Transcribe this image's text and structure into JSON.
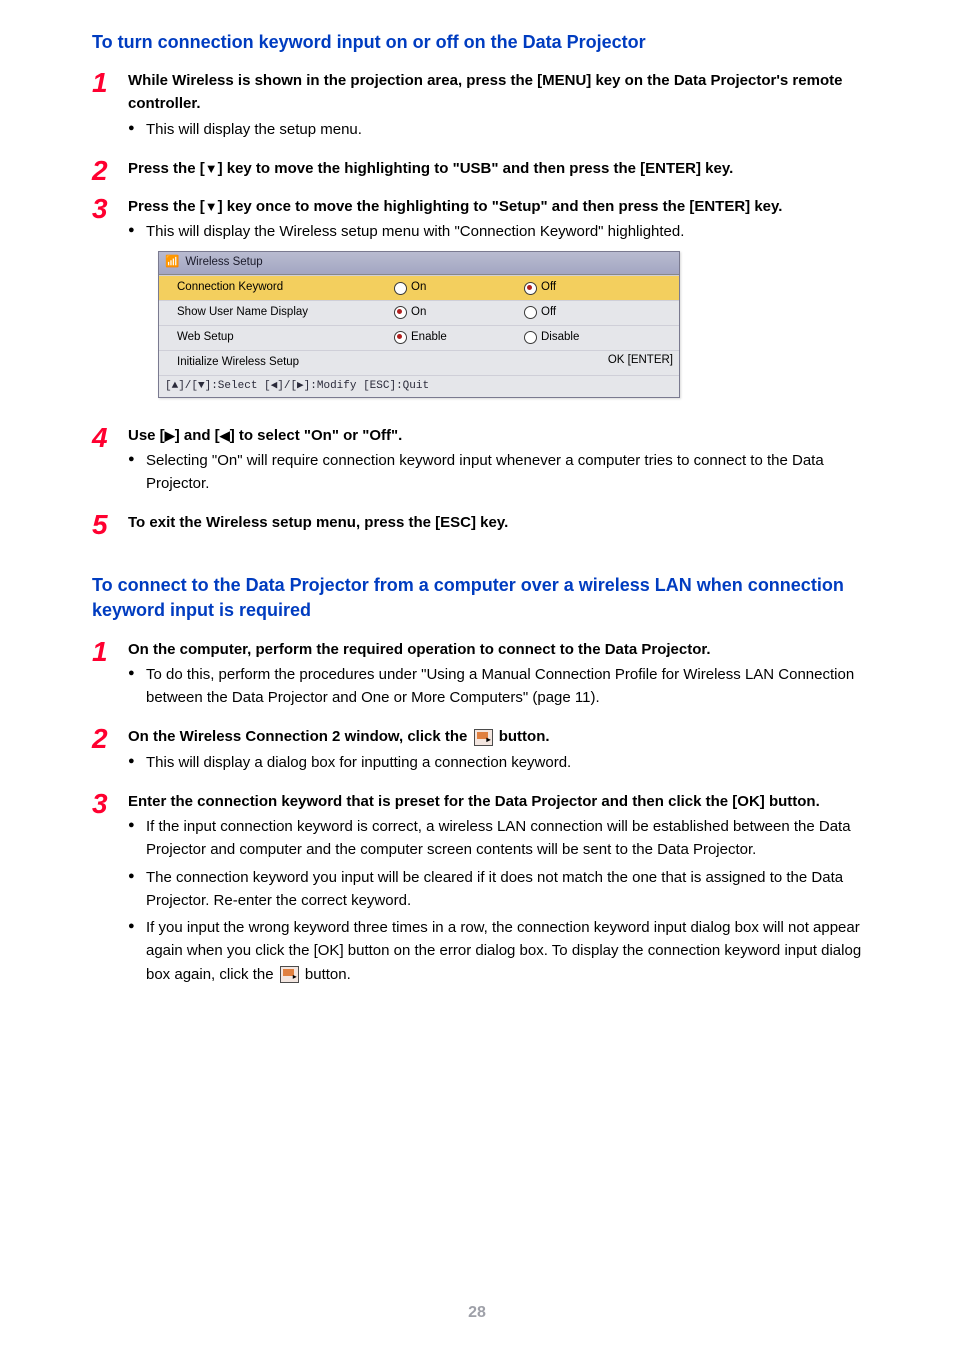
{
  "page_number": "28",
  "section1": {
    "heading": "To turn connection keyword input on or off on the Data Projector",
    "steps": [
      {
        "num": "1",
        "title": "While Wireless is shown in the projection area, press the [MENU] key on the Data Projector's remote controller.",
        "bullets": [
          "This will display the setup menu."
        ]
      },
      {
        "num": "2",
        "title_pre": "Press the [",
        "title_post": "] key to move the highlighting to \"USB\" and then press the [ENTER] key.",
        "bullets": []
      },
      {
        "num": "3",
        "title_pre": "Press the [",
        "title_post": "] key once to move the highlighting to \"Setup\" and then press the [ENTER] key.",
        "bullets": [
          "This will display the Wireless setup menu with \"Connection Keyword\" highlighted."
        ]
      },
      {
        "num": "4",
        "title_pre": "Use [",
        "title_mid": "] and [",
        "title_post": "] to select \"On\" or \"Off\".",
        "bullets": [
          "Selecting \"On\" will require connection keyword input whenever a computer tries to connect to the Data Projector."
        ]
      },
      {
        "num": "5",
        "title": "To exit the Wireless setup menu, press the [ESC] key.",
        "bullets": []
      }
    ]
  },
  "wireless_table": {
    "title": "Wireless Setup",
    "rows": [
      {
        "label": "Connection Keyword",
        "opt1": "On",
        "opt2": "Off",
        "selected": 2,
        "highlight": true
      },
      {
        "label": "Show User Name Display",
        "opt1": "On",
        "opt2": "Off",
        "selected": 1,
        "highlight": false
      },
      {
        "label": "Web Setup",
        "opt1": "Enable",
        "opt2": "Disable",
        "selected": 1,
        "highlight": false
      },
      {
        "label": "Initialize Wireless Setup",
        "opt1": "",
        "opt2": "",
        "ok": "OK [ENTER]",
        "highlight": false
      }
    ],
    "footer": "[▲]/[▼]:Select  [◀]/[▶]:Modify  [ESC]:Quit"
  },
  "section2": {
    "heading": "To connect to the Data Projector from a computer over a wireless LAN when connection keyword input is required",
    "steps": [
      {
        "num": "1",
        "title": "On the computer, perform the required operation to connect to the Data Projector.",
        "bullets": [
          "To do this, perform the procedures under \"Using a Manual Connection Profile for Wireless LAN Connection between the Data Projector and One or More Computers\" (page 11)."
        ]
      },
      {
        "num": "2",
        "title_pre": "On the Wireless Connection 2 window, click the ",
        "title_post": " button.",
        "bullets": [
          "This will display a dialog box for inputting a connection keyword."
        ]
      },
      {
        "num": "3",
        "title": "Enter the connection keyword that is preset for the Data Projector and then click the [OK] button.",
        "bullets": [
          "If the input connection keyword is correct, a wireless LAN connection will be established between the Data Projector and computer and the computer screen contents will be sent to the Data Projector.",
          "The connection keyword you input will be cleared if it does not match the one that is assigned to the Data Projector. Re-enter the correct keyword."
        ],
        "last_bullet_pre": "If you input the wrong keyword three times in a row, the connection keyword input dialog box will not appear again when you click the [OK] button on the error dialog box. To display the connection keyword input dialog box again, click the ",
        "last_bullet_post": " button."
      }
    ]
  },
  "glyphs": {
    "down": "▼",
    "right": "▶",
    "left": "◀"
  }
}
